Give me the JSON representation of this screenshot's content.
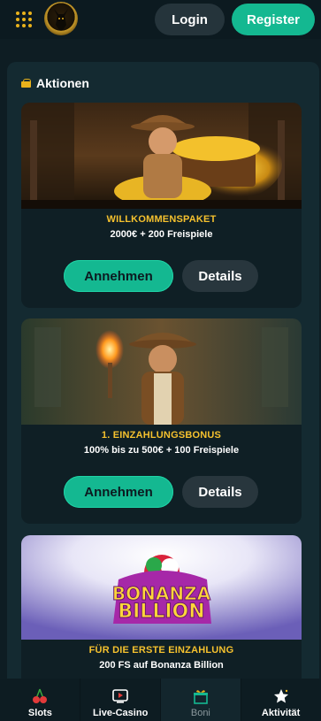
{
  "header": {
    "login_label": "Login",
    "register_label": "Register"
  },
  "section": {
    "title": "Aktionen"
  },
  "promotions": [
    {
      "title": "WILLKOMMENSPAKET",
      "subtitle": "2000€ + 200 Freispiele",
      "accept_label": "Annehmen",
      "details_label": "Details"
    },
    {
      "title": "1. EINZAHLUNGSBONUS",
      "subtitle": "100% bis zu 500€ + 100 Freispiele",
      "accept_label": "Annehmen",
      "details_label": "Details"
    },
    {
      "title": "FÜR DIE ERSTE EINZAHLUNG",
      "subtitle": "200 FS auf Bonanza Billion",
      "banner_text_line1": "BONANZA",
      "banner_text_line2": "BILLION"
    }
  ],
  "bottom_nav": [
    {
      "label": "Slots",
      "icon": "cherry-icon"
    },
    {
      "label": "Live-Casino",
      "icon": "tv-icon"
    },
    {
      "label": "Boni",
      "icon": "gift-icon",
      "active": true
    },
    {
      "label": "Aktivität",
      "icon": "star-icon"
    }
  ],
  "colors": {
    "accent_green": "#14b891",
    "gold": "#f5c12e",
    "background": "#0e1d23"
  }
}
